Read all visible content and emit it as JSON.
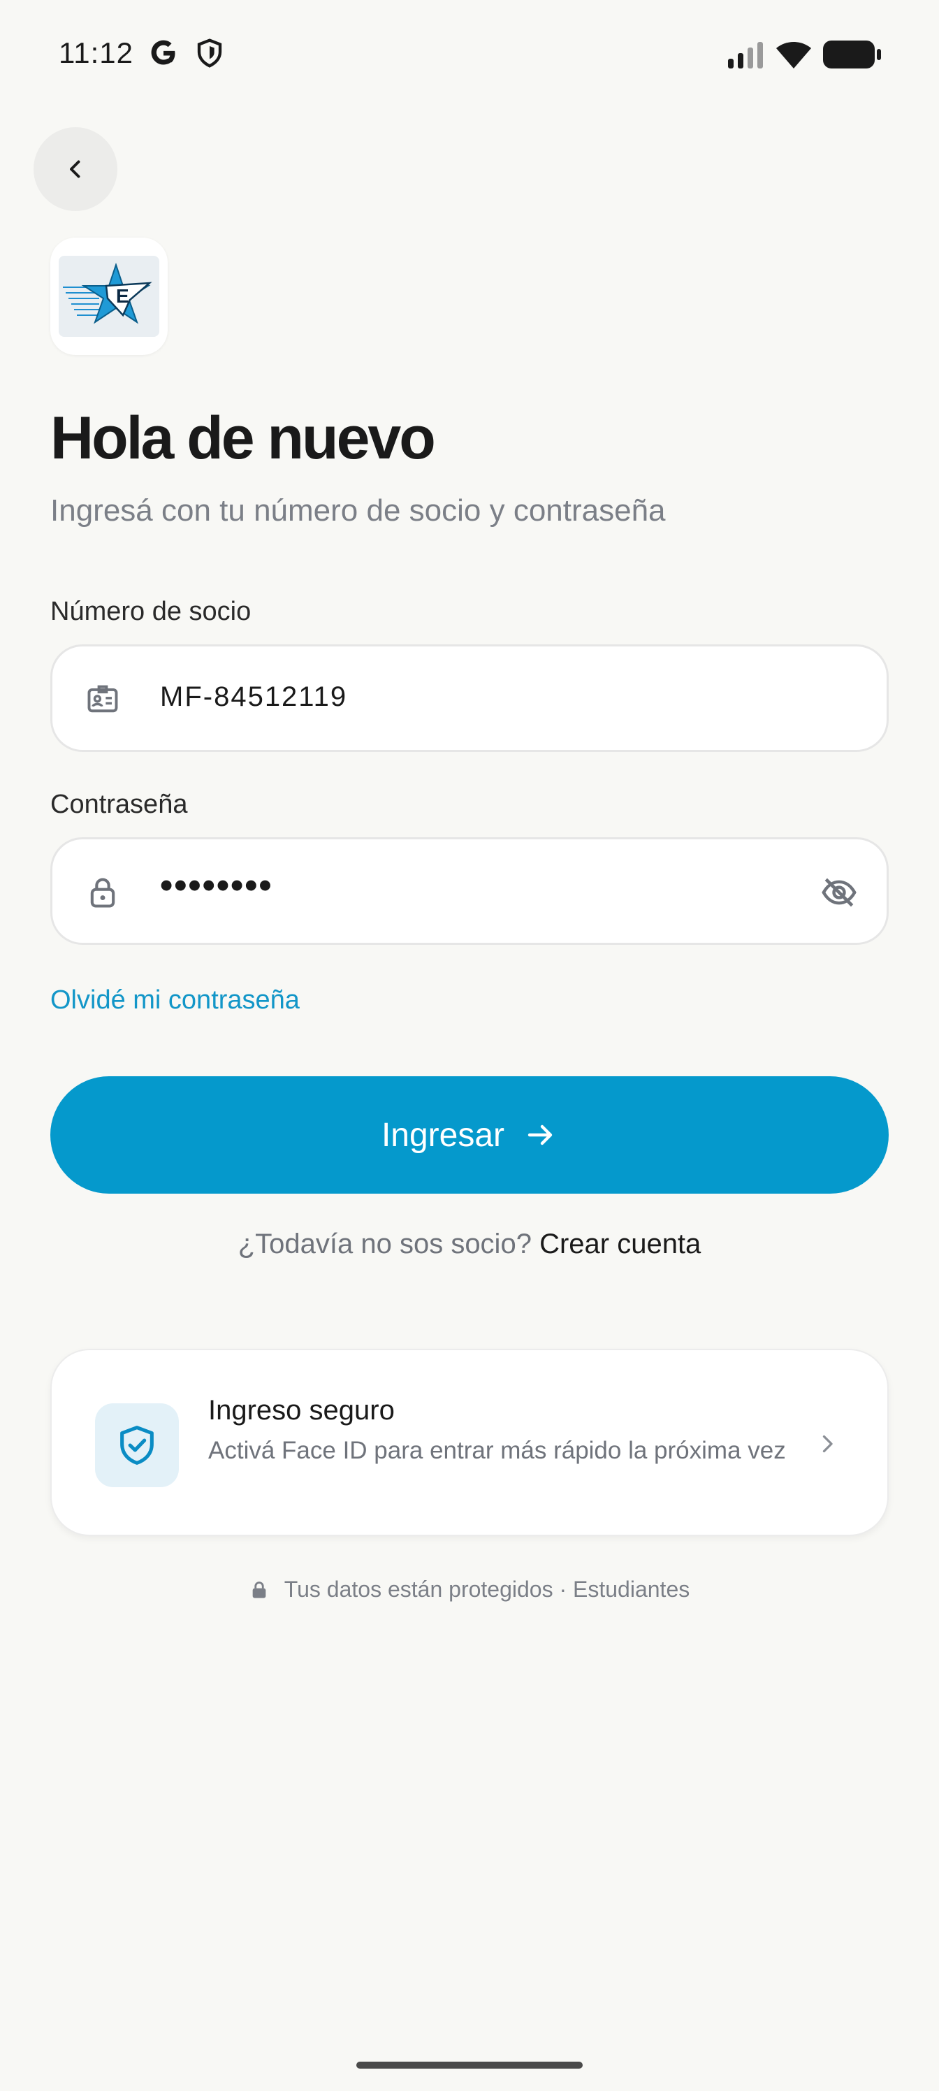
{
  "status_bar": {
    "time": "11:12",
    "icons": [
      "google-icon",
      "shield-icon",
      "signal-icon",
      "wifi-icon",
      "battery-icon"
    ]
  },
  "header": {
    "back_icon": "chevron-left-icon"
  },
  "brand": {
    "logo_letter": "E",
    "colors": {
      "accent": "#0599cc",
      "link": "#1296c8"
    }
  },
  "login": {
    "title": "Hola de nuevo",
    "subtitle": "Ingresá con tu número de socio y contraseña",
    "member_label": "Número de socio",
    "member_value": "MF-84512119",
    "password_label": "Contraseña",
    "password_value": "••••••••",
    "forgot_link": "Olvidé mi contraseña",
    "submit_label": "Ingresar",
    "signup_prompt": "¿Todavía no sos socio?",
    "signup_link": "Crear cuenta"
  },
  "secure_card": {
    "title": "Ingreso seguro",
    "description": "Activá Face ID para entrar más rápido la próxima vez"
  },
  "footer": {
    "note": "Tus datos están protegidos · Estudiantes"
  }
}
